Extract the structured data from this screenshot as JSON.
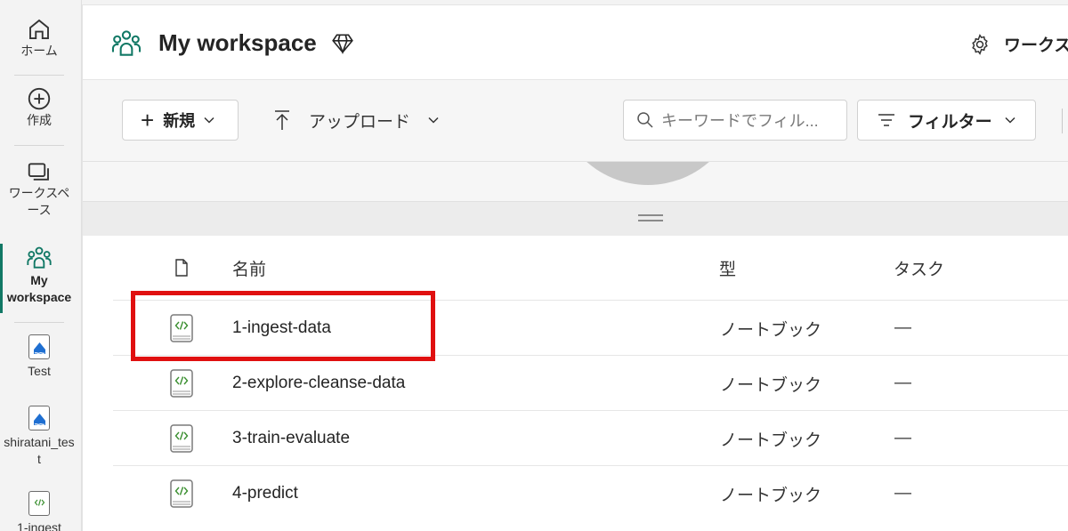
{
  "rail": {
    "home_label": "ホーム",
    "create_label": "作成",
    "workspaces_label": "ワークスペース",
    "my_workspace_label_1": "My",
    "my_workspace_label_2": "workspace",
    "pinned": [
      {
        "label": "Test"
      },
      {
        "label": "shiratani_test"
      },
      {
        "label": "1-ingest"
      }
    ]
  },
  "header": {
    "title": "My workspace",
    "settings_label": "ワークス"
  },
  "toolbar": {
    "new_label": "新規",
    "upload_label": "アップロード",
    "search_placeholder": "キーワードでフィル...",
    "filter_label": "フィルター"
  },
  "table": {
    "columns": {
      "name": "名前",
      "type": "型",
      "task": "タスク"
    },
    "rows": [
      {
        "name": "1-ingest-data",
        "type": "ノートブック",
        "task": "—"
      },
      {
        "name": "2-explore-cleanse-data",
        "type": "ノートブック",
        "task": "—"
      },
      {
        "name": "3-train-evaluate",
        "type": "ノートブック",
        "task": "—"
      },
      {
        "name": "4-predict",
        "type": "ノートブック",
        "task": "—"
      }
    ]
  },
  "colors": {
    "accent": "#117865",
    "highlight": "#e01010"
  }
}
